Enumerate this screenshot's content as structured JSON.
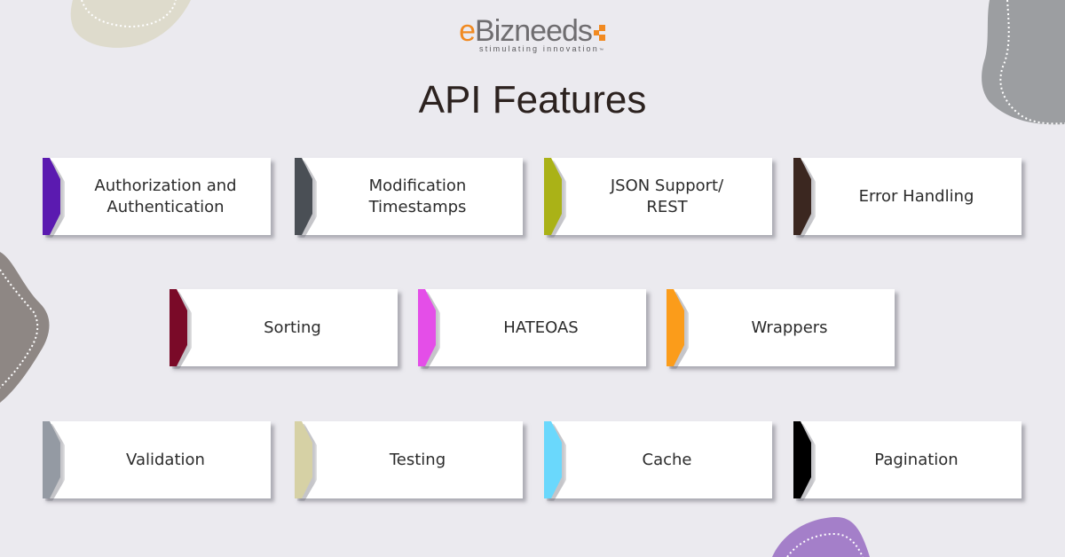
{
  "brand": {
    "name_accent": "e",
    "name_rest": "Bizneeds",
    "tagline": "stimulating innovation",
    "trademark": "™",
    "colors": {
      "orange": "#f18a21",
      "gray": "#6f6d70"
    }
  },
  "title": "API Features",
  "colors": {
    "background": "#ebeaef",
    "card": "#ffffff",
    "title_text": "#2c221f",
    "blob_beige": "#dedbcc",
    "blob_gray": "#9c9ea1",
    "blob_taupe": "#8e8784",
    "blob_purple": "#a47fc9"
  },
  "features": [
    {
      "label": "Authorization and\nAuthentication",
      "color": "#5b1ab0"
    },
    {
      "label": "Modification\nTimestamps",
      "color": "#4a4f55"
    },
    {
      "label": "JSON Support/\nREST",
      "color": "#aab217"
    },
    {
      "label": "Error Handling",
      "color": "#3b2720"
    },
    {
      "label": "Sorting",
      "color": "#7a0a28"
    },
    {
      "label": "HATEOAS",
      "color": "#e44ee8"
    },
    {
      "label": "Wrappers",
      "color": "#fb9c1a"
    },
    {
      "label": "Validation",
      "color": "#949aa3"
    },
    {
      "label": "Testing",
      "color": "#d6d1a5"
    },
    {
      "label": "Cache",
      "color": "#6ad8fc"
    },
    {
      "label": "Pagination",
      "color": "#000000"
    }
  ]
}
